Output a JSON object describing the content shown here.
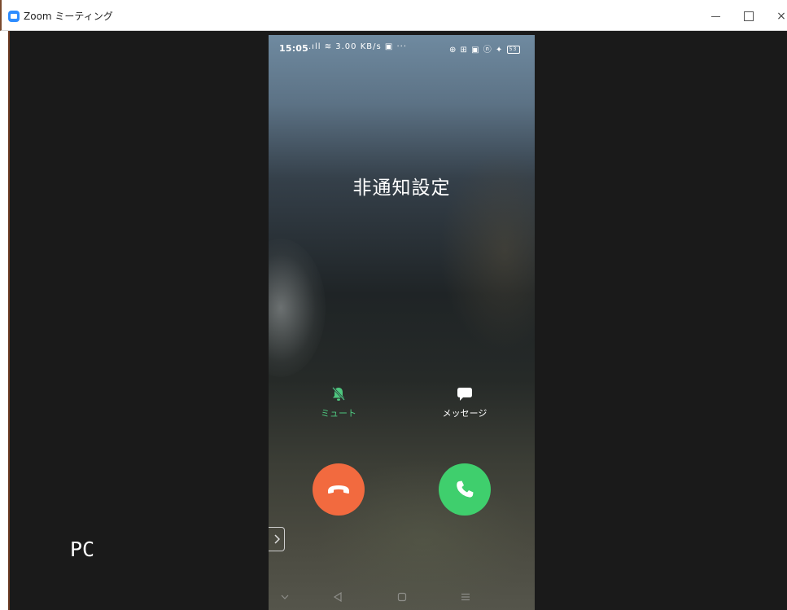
{
  "window": {
    "title": "Zoom ミーティング",
    "icon": "zoom-app-icon",
    "controls": {
      "minimize": "minimize-icon",
      "maximize": "maximize-icon",
      "close": "×"
    }
  },
  "phone": {
    "status_bar": {
      "time": "15:05",
      "left_icons": ".ıll ≋ 3.00 KB/s ▣ ···",
      "right_icons": "⊕ ⊞ ▣ ⓝ ✦",
      "battery": "53"
    },
    "caller_name": "非通知設定",
    "actions": {
      "mute_label": "ミュート",
      "message_label": "メッセージ"
    },
    "buttons": {
      "decline": "phone-hangup-icon",
      "accept": "phone-accept-icon"
    },
    "colors": {
      "decline": "#f26a3f",
      "accept": "#3fcf6d",
      "mute_active": "#4ec77f"
    }
  },
  "overlay_label": "PC"
}
